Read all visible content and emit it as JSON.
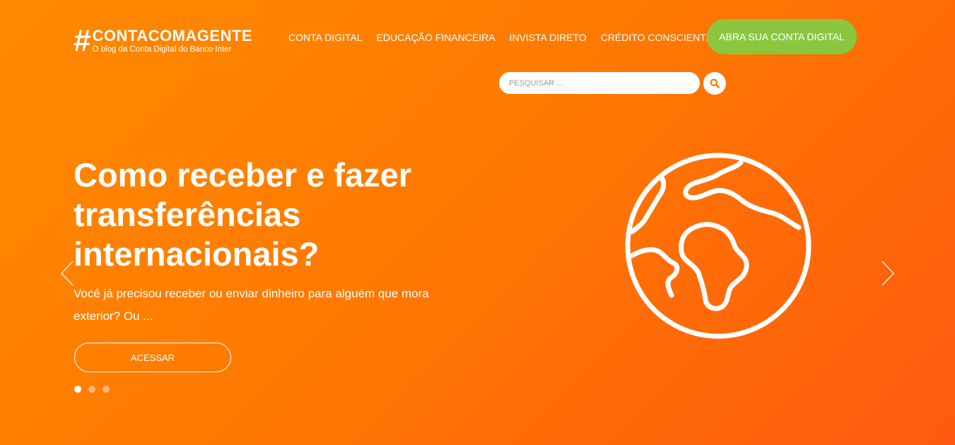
{
  "brand": {
    "hash": "#",
    "name": "CONTACOMAGENTE",
    "tagline": "O blog da Conta Digital do Banco Inter"
  },
  "nav": {
    "items": [
      "CONTA DIGITAL",
      "EDUCAÇÃO FINANCEIRA",
      "INVISTA DIRETO",
      "CRÉDITO CONSCIENTE"
    ]
  },
  "cta": {
    "label": "ABRA SUA CONTA DIGITAL"
  },
  "search": {
    "placeholder": "PESQUISAR ...",
    "value": "",
    "icon": "search-icon"
  },
  "slide": {
    "title": "Como receber e fazer transferências internacionais?",
    "excerpt": "Você já precisou receber ou enviar dinheiro para alguém que mora exterior? Ou ...",
    "button_label": "ACESSAR",
    "illustration_icon": "globe-icon",
    "active_index": 0,
    "count": 3
  },
  "colors": {
    "background_start": "#ff8a00",
    "background_end": "#ff5a10",
    "cta_green": "#8cc63f",
    "text": "#ffffff",
    "search_icon": "#ff7a00"
  }
}
